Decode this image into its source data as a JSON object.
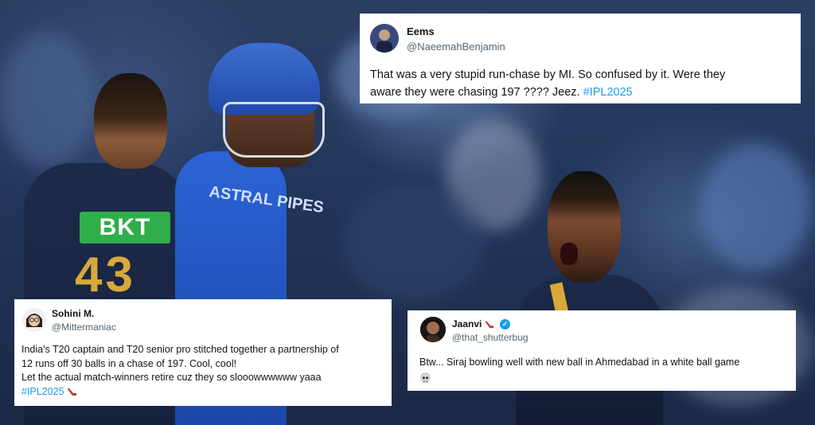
{
  "background": {
    "jersey_sponsor": "BKT",
    "jersey_number": "43",
    "batter_shirt_text": "ASTRAL PIPES"
  },
  "tweets": [
    {
      "name": "Eems",
      "handle": "@NaeemahBenjamin",
      "text_lines": [
        "That was a very stupid run-chase by MI. So confused by it. Were they",
        "aware they were chasing 197 ???? Jeez."
      ],
      "hashtag": "#IPL2025"
    },
    {
      "name": "Sohini M.",
      "handle": "@Mittermaniac",
      "text_lines": [
        "India's T20 captain and T20 senior pro stitched together a partnership of",
        "12 runs off 30 balls in a chase of 197. Cool, cool!",
        "Let the actual match-winners retire cuz they so slooowwwwww yaaa"
      ],
      "hashtag": "#IPL2025",
      "trailing_emoji": "ice-hockey-stick-emoji"
    },
    {
      "name": "Jaanvi",
      "name_emoji": "ice-hockey-stick-emoji",
      "verified": true,
      "handle": "@that_shutterbug",
      "text_lines": [
        "Btw... Siraj bowling well with new ball in Ahmedabad in a white ball game"
      ],
      "trailing_emoji": "skull-emoji"
    }
  ],
  "colors": {
    "hashtag": "#1d9bf0",
    "handle": "#536471",
    "verified": "#1d9bf0",
    "gt_navy": "#1d2a4a",
    "mi_blue": "#2c63d6",
    "gold": "#d7a93a",
    "bkt_green": "#2fae4a"
  }
}
